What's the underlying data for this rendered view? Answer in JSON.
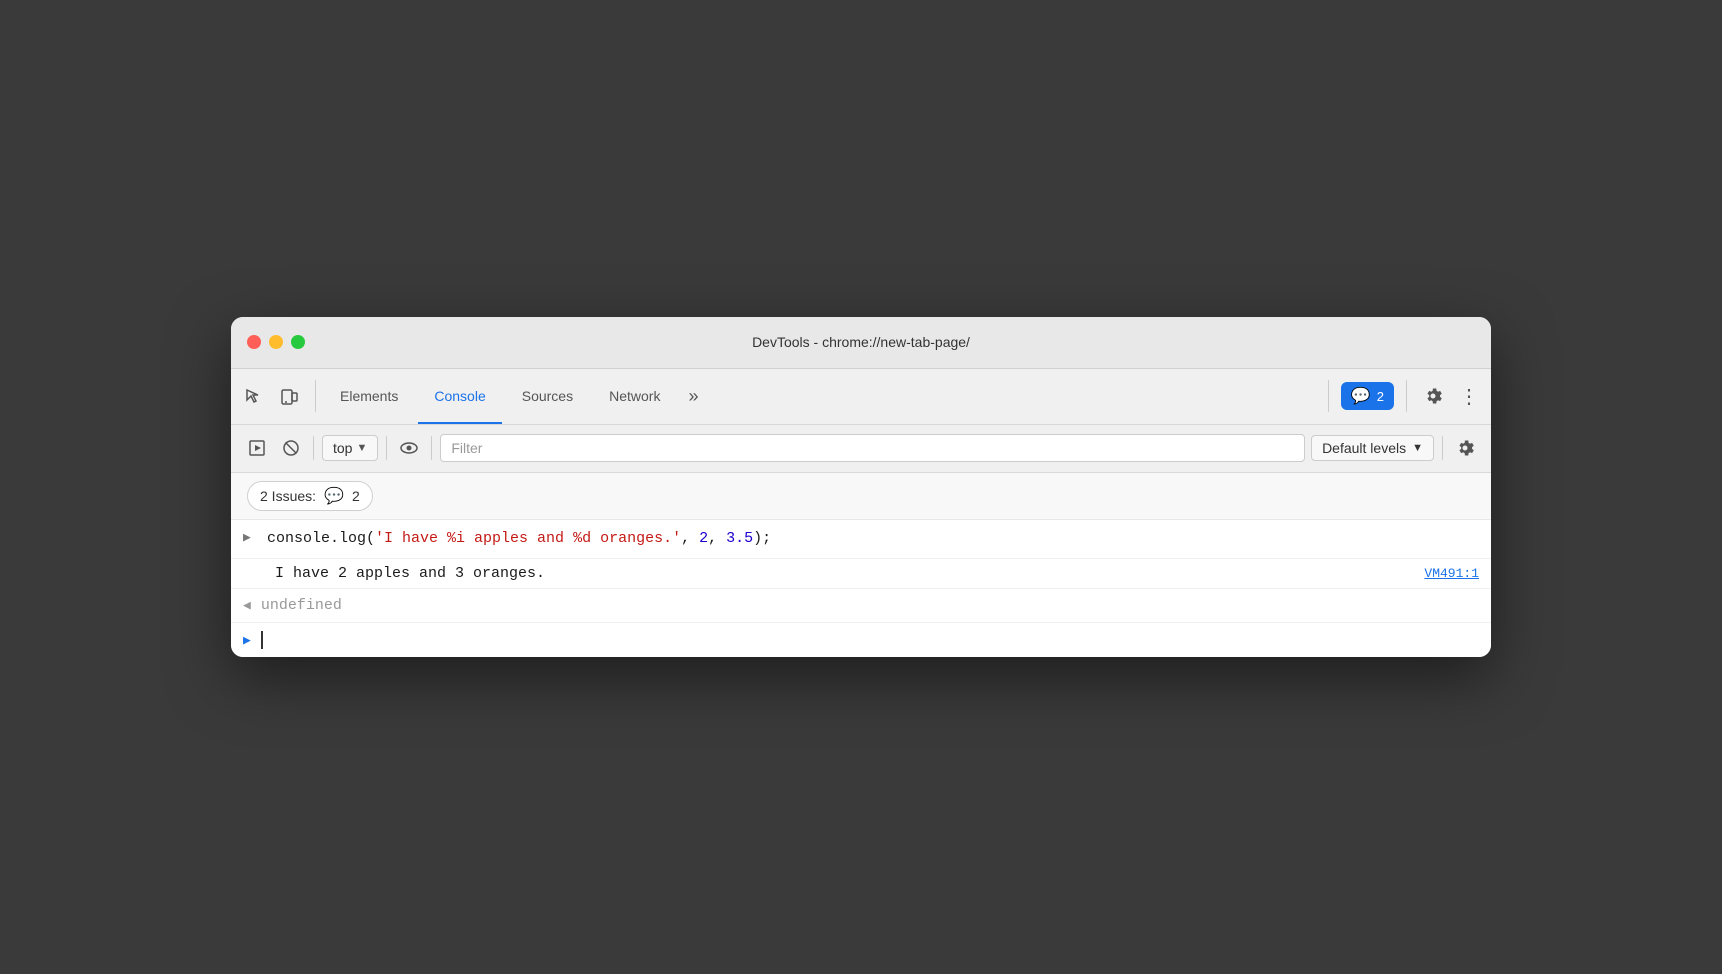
{
  "titlebar": {
    "title": "DevTools - chrome://new-tab-page/"
  },
  "tabs": {
    "items": [
      {
        "label": "Elements",
        "active": false
      },
      {
        "label": "Console",
        "active": true
      },
      {
        "label": "Sources",
        "active": false
      },
      {
        "label": "Network",
        "active": false
      }
    ],
    "more_label": "»",
    "issues_count": "2",
    "issues_label": "2"
  },
  "toolbar": {
    "context_selector": "top",
    "filter_placeholder": "Filter",
    "levels_label": "Default levels"
  },
  "issues_bar": {
    "label": "2 Issues:",
    "count": "2"
  },
  "console": {
    "log_entry": {
      "code_prefix": "console.log(",
      "string_part": "'I have %i apples and %d oranges.'",
      "comma1": ", ",
      "num1": "2",
      "comma2": ", ",
      "num2": "3.5",
      "code_suffix": ");"
    },
    "output_text": "I have 2 apples and 3 oranges.",
    "output_source": "VM491:1",
    "undefined_text": "undefined"
  }
}
